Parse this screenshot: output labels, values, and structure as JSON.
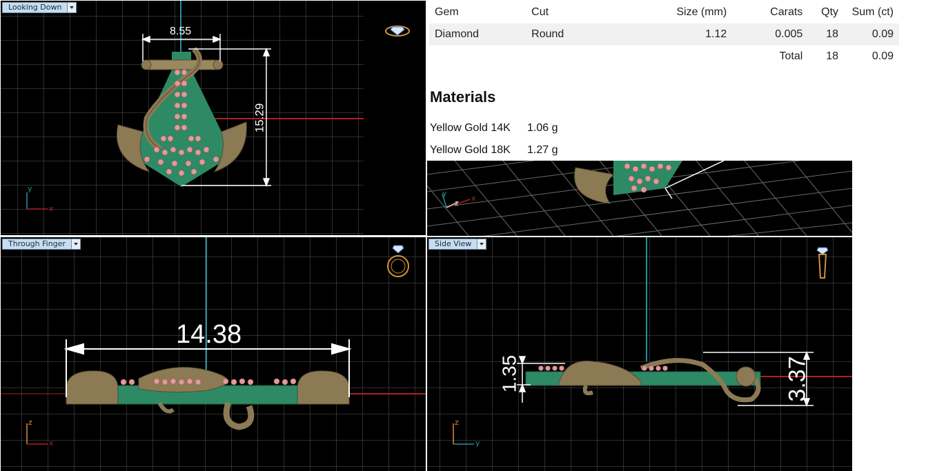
{
  "viewports": {
    "top": {
      "label": "Looking Down",
      "dim_width": "8.55",
      "dim_height": "15.29",
      "axis_a": "y",
      "axis_b": "x"
    },
    "front": {
      "label": "Through Finger",
      "dim_width": "14.38",
      "axis_a": "z",
      "axis_b": "x"
    },
    "side": {
      "label": "Side View",
      "dim_thickness": "1.35",
      "dim_height": "3.37",
      "axis_a": "z",
      "axis_b": "y"
    },
    "persp": {
      "axis_a": "y",
      "axis_b": "z",
      "axis_c": "x"
    }
  },
  "gem_table": {
    "headers": [
      "Gem",
      "Cut",
      "Size (mm)",
      "Carats",
      "Qty",
      "Sum (ct)"
    ],
    "rows": [
      [
        "Diamond",
        "Round",
        "1.12",
        "0.005",
        "18",
        "0.09"
      ]
    ],
    "total": {
      "label": "Total",
      "qty": "18",
      "sum": "0.09"
    }
  },
  "materials": {
    "title": "Materials",
    "items": [
      {
        "name": "Yellow Gold 14K",
        "weight": "1.06 g"
      },
      {
        "name": "Yellow Gold 18K",
        "weight": "1.27 g"
      }
    ]
  },
  "colors": {
    "viewport_bg": "#000000",
    "grid": "#5a5a5a",
    "axis_v": "#2a8fa0",
    "axis_h": "#b02020",
    "gold": "#8c7a55",
    "green_base": "#2e8a64",
    "gem_pink": "#e39a9a",
    "label_bg": "#c6dcef"
  },
  "icons": [
    "ring-top-view-icon",
    "ring-front-view-icon",
    "ring-side-view-icon",
    "axis-triad-icon",
    "dropdown-arrow-icon"
  ]
}
